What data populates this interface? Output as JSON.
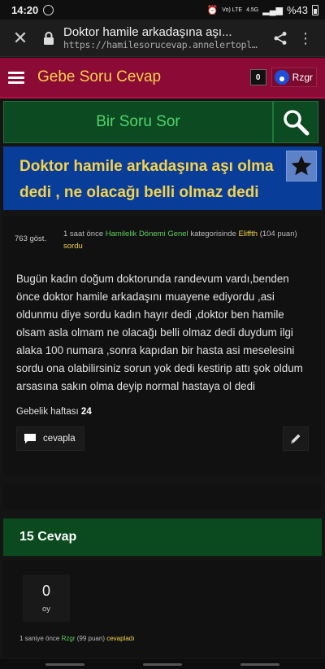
{
  "status_bar": {
    "time": "14:20",
    "network": "4.5G",
    "lte": "Vo) LTE",
    "battery": "%43"
  },
  "browser": {
    "page_title": "Doktor hamile arkadaşına aşı...",
    "url": "https://hamilesorucevap.annelertopland..."
  },
  "site": {
    "title": "Gebe Soru Cevap",
    "notification_count": "0",
    "username": "Rzgr"
  },
  "ask": {
    "label": "Bir Soru Sor"
  },
  "question": {
    "title": "Doktor hamile arkadaşına aşı olma dedi , ne olacağı belli olmaz dedi",
    "views": "763 göst.",
    "meta": {
      "time": "1 saat önce",
      "category": "Hamilelik Dönemi Genel",
      "category_suffix": "kategorisinde",
      "author": "Eliffth",
      "points": "(104 puan)",
      "action": "sordu"
    },
    "body": "Bugün kadın doğum doktorunda randevum vardı,benden önce doktor hamile arkadaşını muayene ediyordu ,asi oldunmu diye sordu kadın hayır dedi ,doktor ben hamile olsam asla olmam ne olacağı belli olmaz dedi duydum ilgi alaka 100 numara ,sonra kapıdan bir hasta  asi meselesini sordu  ona olabilirsiniz sorun yok dedi kestirip attı şok oldum  arsasına sakın olma deyip normal hastaya ol dedi",
    "week_label": "Gebelik haftası",
    "week_value": "24",
    "reply_label": "cevapla"
  },
  "answers": {
    "header": "15 Cevap",
    "items": [
      {
        "votes": "0",
        "votes_label": "oy",
        "time": "1 saniye önce",
        "author": "Rzgr",
        "points": "(99 puan)",
        "action": "cevapladı"
      }
    ]
  },
  "colors": {
    "header_bg": "#8c0a36",
    "title_yellow": "#f4d34b",
    "ask_green": "#0c4a22",
    "title_blue": "#093d9a",
    "answers_green": "#0a4a1e"
  }
}
